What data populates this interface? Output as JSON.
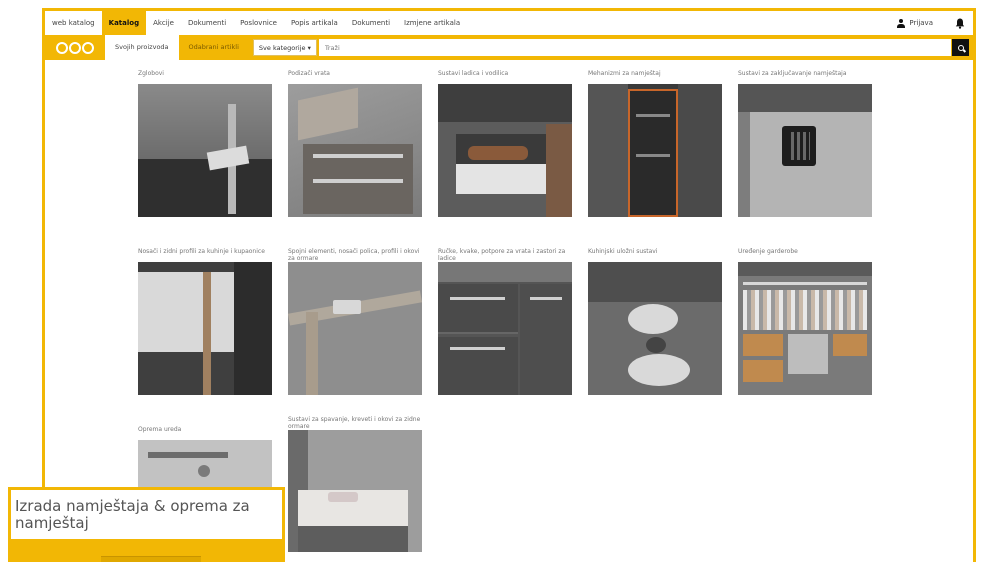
{
  "nav": {
    "items": [
      "web katalog",
      "Katalog",
      "Akcije",
      "Dokumenti",
      "Poslovnice",
      "Popis artikala",
      "Dokumenti",
      "Izmjene artikala"
    ],
    "active_index": 1,
    "login_label": "Prijava"
  },
  "toolbar": {
    "tabs": [
      "Svojih proizvoda",
      "Odabrani artikli"
    ],
    "category_select": "Sve kategorije ▾",
    "search_placeholder": "Traži"
  },
  "categories": [
    {
      "label": "Zglobovi"
    },
    {
      "label": "Podizači vrata"
    },
    {
      "label": "Sustavi ladica i vodilica"
    },
    {
      "label": "Mehanizmi za namještaj"
    },
    {
      "label": "Sustavi za zaključavanje namještaja"
    },
    {
      "label": "Nosači i zidni profili za kuhinje i kupaonice"
    },
    {
      "label": "Spojni elementi, nosači polica, profili i okovi za ormare"
    },
    {
      "label": "Ručke, kvake, potpore za vrata i zastori za ladice"
    },
    {
      "label": "Kuhinjski uložni sustavi"
    },
    {
      "label": "Uređenje garderobe"
    },
    {
      "label": "Oprema ureda"
    },
    {
      "label": "Sustavi za spavanje, kreveti i okovi za zidne ormare"
    }
  ],
  "popup": {
    "title": "Izrada namještaja & oprema za namještaj"
  },
  "colors": {
    "brand_yellow": "#f2b705",
    "dark": "#111111"
  }
}
